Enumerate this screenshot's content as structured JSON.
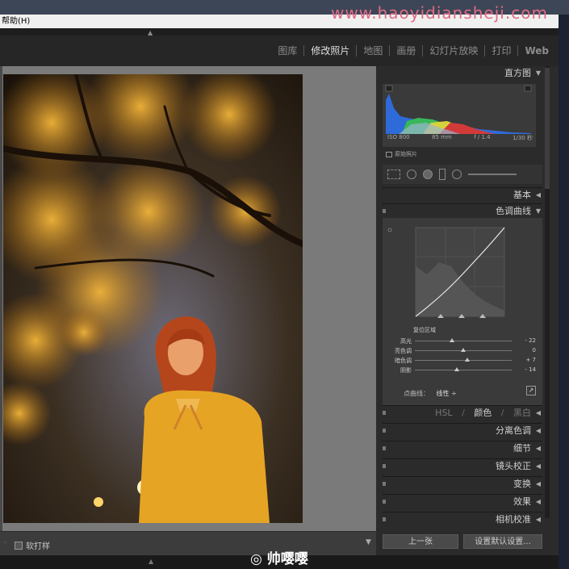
{
  "menubar": {
    "help": "帮助(H)"
  },
  "watermark": "www.haoyidiansheji.com",
  "modules": [
    {
      "label": "图库",
      "active": false
    },
    {
      "label": "修改照片",
      "active": true
    },
    {
      "label": "地图",
      "active": false
    },
    {
      "label": "画册",
      "active": false
    },
    {
      "label": "幻灯片放映",
      "active": false
    },
    {
      "label": "打印",
      "active": false
    },
    {
      "label": "Web",
      "active": false
    }
  ],
  "panels": {
    "histogram": {
      "title": "直方图",
      "iso": "ISO 800",
      "focal": "85 mm",
      "aperture": "f / 1.4",
      "shutter": "1/30 秒",
      "original": "原始照片"
    },
    "basic": {
      "title": "基本"
    },
    "tone_curve": {
      "title": "色调曲线",
      "region_title": "复位区域",
      "sliders": [
        {
          "label": "高光",
          "value": "- 22",
          "pos": 0.39
        },
        {
          "label": "亮色调",
          "value": "0",
          "pos": 0.5
        },
        {
          "label": "暗色调",
          "value": "+ 7",
          "pos": 0.54
        },
        {
          "label": "阴影",
          "value": "- 14",
          "pos": 0.43
        }
      ],
      "point_curve_label": "点曲线：",
      "point_curve_value": "线性 ÷"
    },
    "hsl": {
      "hsl": "HSL",
      "color": "颜色",
      "bw": "黑白"
    },
    "split": {
      "title": "分离色调"
    },
    "detail": {
      "title": "细节"
    },
    "lens": {
      "title": "镜头校正"
    },
    "transform": {
      "title": "变换"
    },
    "effects": {
      "title": "效果"
    },
    "calibration": {
      "title": "相机校准"
    }
  },
  "buttons": {
    "prev": "上一张",
    "reset": "设置默认设置..."
  },
  "toolbar": {
    "softproof": "软打样"
  },
  "signature": "帅嘤嘤",
  "colors": {
    "accent_watermark": "#e06b86",
    "panel_bg": "#2b2b2b"
  }
}
